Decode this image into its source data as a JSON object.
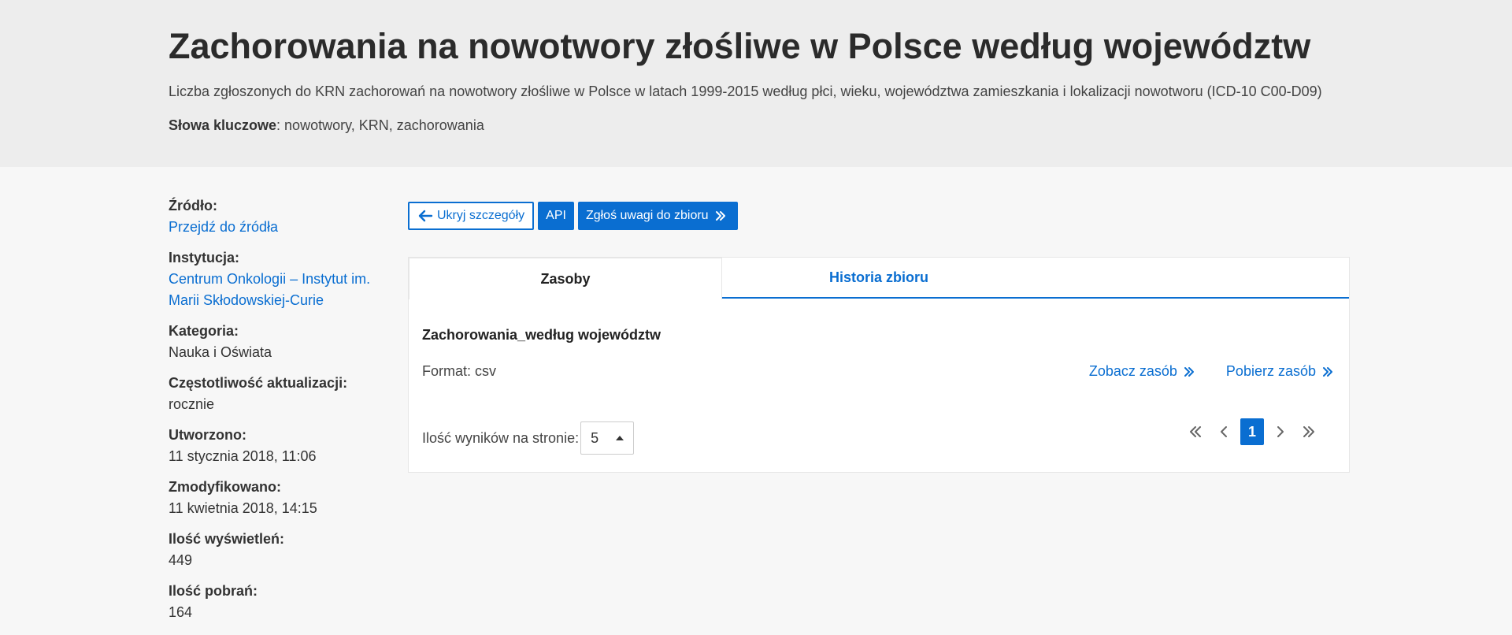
{
  "header": {
    "title": "Zachorowania na nowotwory złośliwe w Polsce według województw",
    "description": "Liczba zgłoszonych do KRN zachorowań na nowotwory złośliwe w Polsce w latach 1999-2015 według płci, wieku, województwa zamieszkania i lokalizacji nowotworu (ICD-10 C00-D09)",
    "keywords_label": "Słowa kluczowe",
    "keywords_value": ": nowotwory, KRN, zachorowania"
  },
  "sidebar": {
    "source_label": "Źródło:",
    "source_link": "Przejdź do źródła",
    "institution_label": "Instytucja:",
    "institution_line1": "Centrum Onkologii – Instytut im.",
    "institution_line2": "Marii Skłodowskiej-Curie",
    "category_label": "Kategoria:",
    "category_value": "Nauka i Oświata",
    "frequency_label": "Częstotliwość aktualizacji:",
    "frequency_value": "rocznie",
    "created_label": "Utworzono:",
    "created_value": "11 stycznia 2018, 11:06",
    "modified_label": "Zmodyfikowano:",
    "modified_value": "11 kwietnia 2018, 14:15",
    "views_label": "Ilość wyświetleń:",
    "views_value": "449",
    "downloads_label": "Ilość pobrań:",
    "downloads_value": "164"
  },
  "toolbar": {
    "hide_details": "Ukryj szczegóły",
    "api": "API",
    "report": "Zgłoś uwagi do zbioru"
  },
  "tabs": {
    "resources": "Zasoby",
    "history": "Historia zbioru"
  },
  "resource": {
    "title": "Zachorowania_według województw",
    "format": "Format: csv",
    "view_link": "Zobacz zasób",
    "download_link": "Pobierz zasób"
  },
  "pagination": {
    "per_page_label": "Ilość wyników na stronie:",
    "per_page_value": "5",
    "current_page": "1"
  },
  "colors": {
    "accent": "#0a6ed1",
    "header_bg": "#ededed",
    "page_bg": "#f7f7f7"
  }
}
